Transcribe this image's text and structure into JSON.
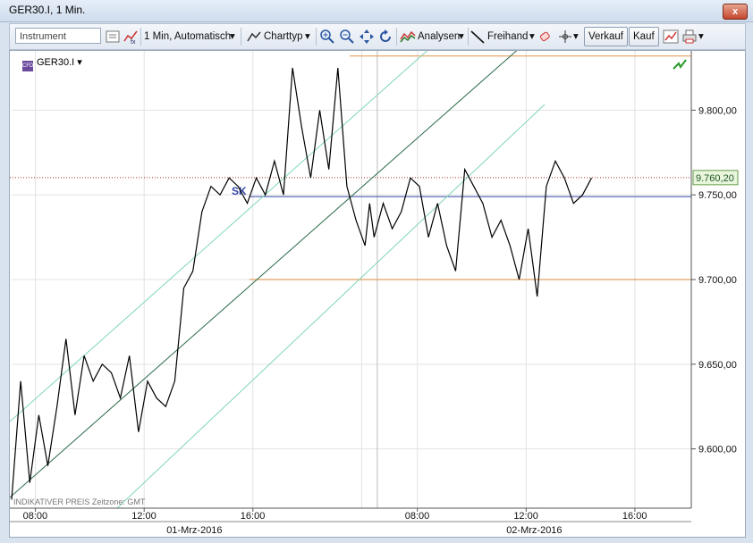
{
  "window": {
    "title": "GER30.I, 1 Min.",
    "close_label": "x"
  },
  "toolbar": {
    "instrument_placeholder": "Instrument",
    "timeframe": "1 Min,  Automatisch",
    "chart_type": "Charttyp",
    "analyses": "Analysen",
    "freehand": "Freihand",
    "sell": "Verkauf",
    "buy": "Kauf"
  },
  "chart": {
    "instrument": "GER30.I",
    "footer_note": "INDIKATIVER PREIS   Zeitzone: GMT",
    "sk_label": "SK",
    "current_price": "9.760,20",
    "y_ticks": [
      "9.800,00",
      "9.750,00",
      "9.700,00",
      "9.650,00",
      "9.600,00"
    ],
    "x_ticks": [
      "08:00",
      "12:00",
      "16:00",
      "08:00",
      "12:00",
      "16:00"
    ],
    "dates": [
      "01-Mrz-2016",
      "02-Mrz-2016"
    ]
  },
  "chart_data": {
    "type": "line",
    "ylim": [
      9565,
      9835
    ],
    "x": [
      0,
      10,
      20,
      30,
      40,
      50,
      60,
      70,
      80,
      90,
      100,
      110,
      120,
      130,
      140,
      150,
      160,
      170,
      180,
      190,
      200,
      210,
      220,
      230,
      240,
      250,
      260,
      270,
      280,
      290,
      300,
      310,
      320,
      330,
      340,
      350,
      360,
      370,
      380,
      390,
      395,
      400,
      410,
      420,
      430,
      440,
      450,
      460,
      470,
      480,
      490,
      500,
      510,
      520,
      530,
      540,
      550,
      560,
      570,
      580,
      590,
      600,
      610,
      620,
      630,
      640,
      650,
      660,
      670,
      680,
      690,
      700,
      710,
      720,
      730,
      740,
      750
    ],
    "values": [
      9570,
      9640,
      9580,
      9620,
      9590,
      9625,
      9665,
      9620,
      9655,
      9640,
      9650,
      9645,
      9630,
      9655,
      9610,
      9640,
      9630,
      9625,
      9640,
      9695,
      9705,
      9740,
      9755,
      9750,
      9760,
      9755,
      9745,
      9760,
      9750,
      9770,
      9750,
      9825,
      9790,
      9760,
      9800,
      9765,
      9825,
      9755,
      9735,
      9720,
      9745,
      9725,
      9745,
      9730,
      9740,
      9760,
      9755,
      9725,
      9745,
      9720,
      9705,
      9765,
      9755,
      9745,
      9725,
      9735,
      9720,
      9700,
      9730,
      9690,
      9755,
      9770,
      9760,
      9745,
      9750,
      9760
    ],
    "current": 9760.2,
    "horizontal_levels": {
      "resistance_top": 9832,
      "sk": 9749,
      "support": 9700
    },
    "colors": {
      "price": "#000000",
      "channel": "#7fd6b5",
      "trend": "#2d6b4a",
      "sk": "#3344aa",
      "support": "#e0a060",
      "current_tag": "#e8f6dc"
    }
  }
}
